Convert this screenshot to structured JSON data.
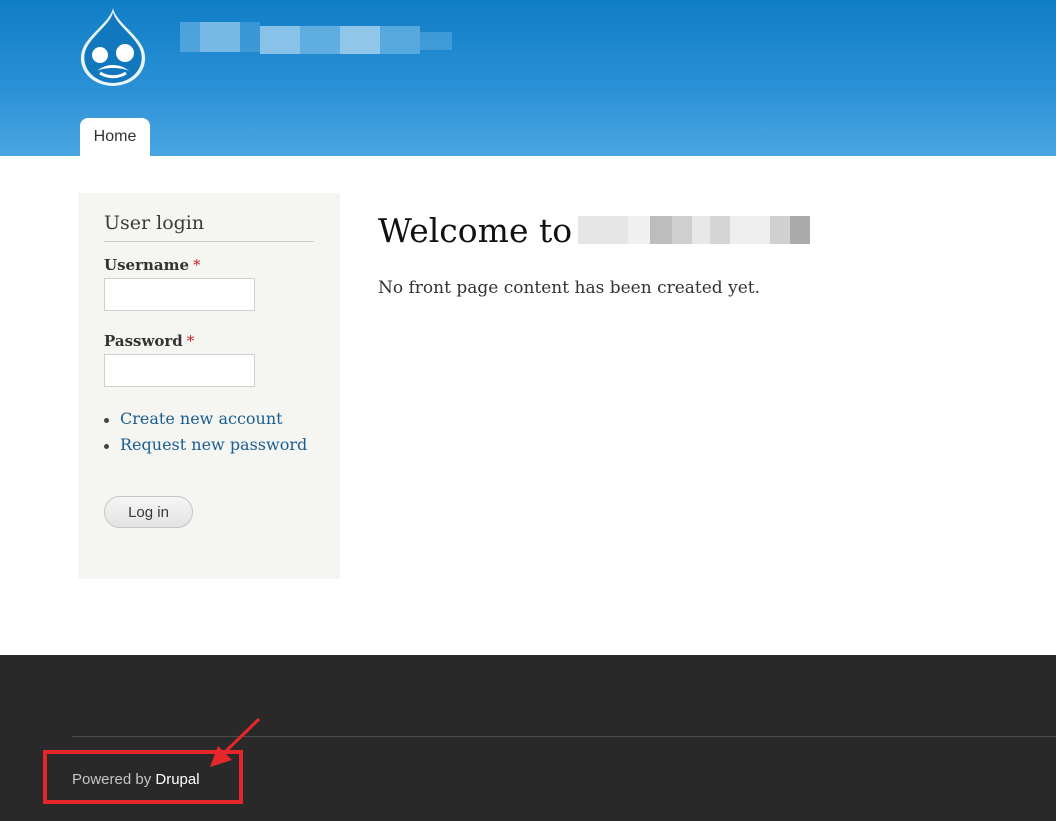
{
  "header": {
    "logo_icon": "drupal-drop-icon",
    "nav": [
      {
        "label": "Home"
      }
    ],
    "colors": {
      "gradient_top": "#0f7dc6",
      "gradient_bottom": "#4aa6e3"
    }
  },
  "login_block": {
    "title": "User login",
    "username_label": "Username",
    "password_label": "Password",
    "required_marker": "*",
    "links": [
      "Create new account",
      "Request new password"
    ],
    "submit_label": "Log in"
  },
  "main": {
    "heading": "Welcome to",
    "body_text": "No front page content has been created yet."
  },
  "footer": {
    "powered_text": "Powered by",
    "powered_link": "Drupal",
    "annotation_color": "#e5262b"
  }
}
